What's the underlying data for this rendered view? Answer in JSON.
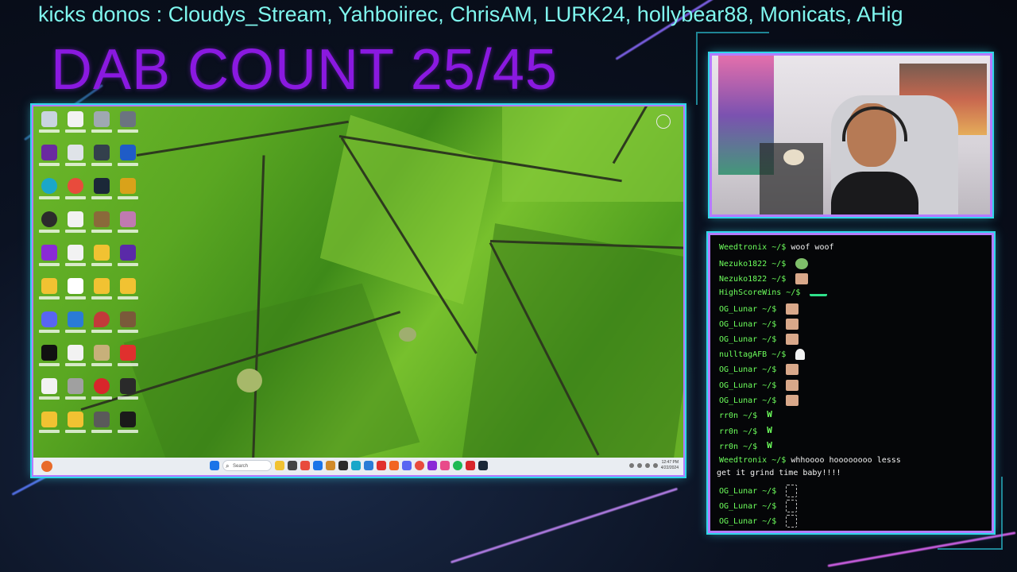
{
  "ticker": {
    "text": "kicks donos : Cloudys_Stream, Yahboiirec, ChrisAM, LURK24, hollybear88, Monicats, AHig"
  },
  "overlay": {
    "dab_count": "DAB COUNT 25/45"
  },
  "desktop": {
    "taskbar": {
      "search_placeholder": "Search"
    },
    "tray": {
      "time": "12:47 PM",
      "date": "4/22/2024"
    }
  },
  "colors": {
    "ticker": "#7ff6ee",
    "dab": "#8a19e0",
    "frame_outer": "#2fd6e8",
    "frame_inner": "#b57bff",
    "chat_user": "#6dff5c"
  },
  "chat": {
    "prompt_suffix": " ~/$ ",
    "messages": [
      {
        "user": "Weedtronix",
        "text": "woof woof",
        "emote": ""
      },
      {
        "user": "Nezuko1822",
        "text": "",
        "emote": "heart-emote"
      },
      {
        "user": "Nezuko1822",
        "text": "",
        "emote": "face-emote"
      },
      {
        "user": "HighScoreWins",
        "text": "",
        "emote": "bar-emote"
      },
      {
        "user": "OG_Lunar",
        "text": "",
        "emote": "face-emote"
      },
      {
        "user": "OG_Lunar",
        "text": "",
        "emote": "face-emote"
      },
      {
        "user": "OG_Lunar",
        "text": "",
        "emote": "face-emote"
      },
      {
        "user": "nulltagAFB",
        "text": "",
        "emote": "ghost-emote"
      },
      {
        "user": "OG_Lunar",
        "text": "",
        "emote": "face-emote"
      },
      {
        "user": "OG_Lunar",
        "text": "",
        "emote": "face-emote"
      },
      {
        "user": "OG_Lunar",
        "text": "",
        "emote": "face-emote"
      },
      {
        "user": "rr0n",
        "text": "",
        "emote": "w-emote"
      },
      {
        "user": "rr0n",
        "text": "",
        "emote": "w-emote"
      },
      {
        "user": "rr0n",
        "text": "",
        "emote": "w-emote"
      },
      {
        "user": "Weedtronix",
        "text": "whhoooo hoooooooo lesss",
        "emote": ""
      },
      {
        "user": "",
        "text": "get it grind time baby!!!!",
        "emote": ""
      },
      {
        "user": "OG_Lunar",
        "text": "",
        "emote": "bracket-emote"
      },
      {
        "user": "OG_Lunar",
        "text": "",
        "emote": "bracket-emote"
      },
      {
        "user": "OG_Lunar",
        "text": "",
        "emote": "bracket-emote"
      }
    ]
  }
}
